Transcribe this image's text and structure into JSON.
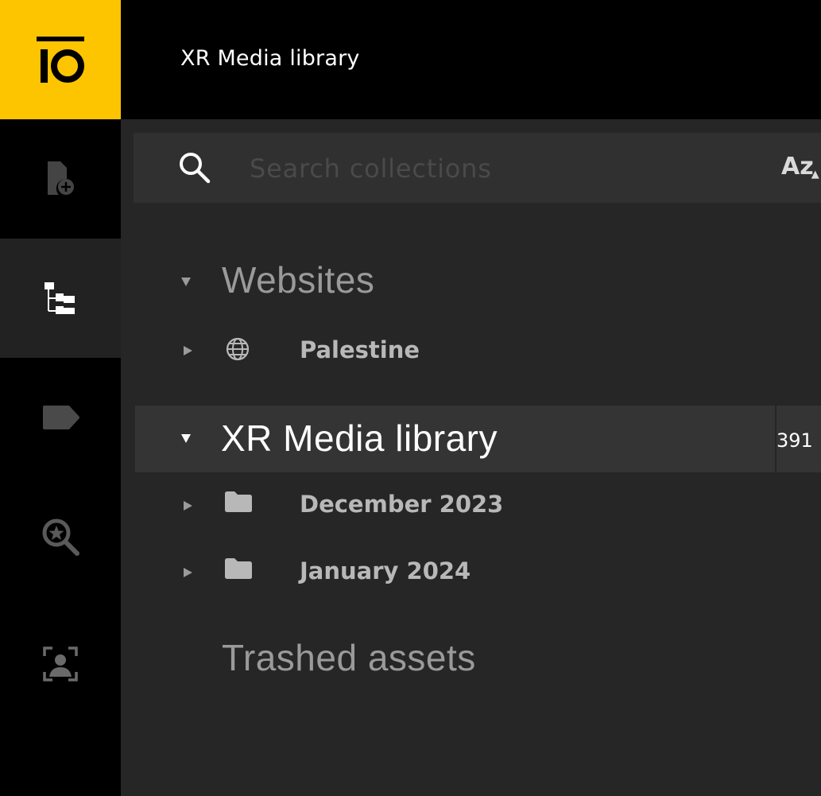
{
  "app": {
    "logo_label": "IO",
    "brand_color": "#fdc400"
  },
  "header": {
    "title": "XR Media library"
  },
  "rail": {
    "items": [
      {
        "name": "upload",
        "icon": "file-add-icon"
      },
      {
        "name": "collections",
        "icon": "tree-icon",
        "active": true
      },
      {
        "name": "labels",
        "icon": "label-icon"
      },
      {
        "name": "saved-searches",
        "icon": "search-star-icon"
      },
      {
        "name": "people",
        "icon": "face-recognition-icon"
      }
    ]
  },
  "search": {
    "placeholder": "Search collections",
    "value": "",
    "sort_label": "Az",
    "sort_sub": "▲"
  },
  "tree": {
    "websites": {
      "label": "Websites",
      "children": [
        {
          "label": "Palestine",
          "icon": "globe-icon"
        }
      ]
    },
    "library": {
      "label": "XR Media library",
      "count": "391",
      "children": [
        {
          "label": "December 2023",
          "icon": "folder-icon"
        },
        {
          "label": "January 2024",
          "icon": "folder-icon"
        }
      ]
    },
    "trash": {
      "label": "Trashed assets"
    }
  }
}
